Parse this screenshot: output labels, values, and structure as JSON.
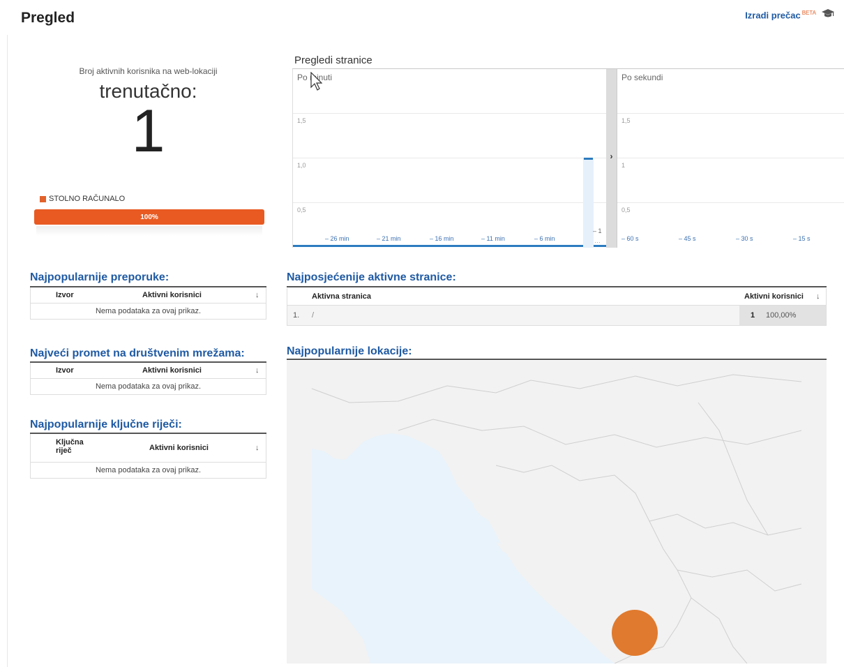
{
  "header": {
    "title": "Pregled",
    "shortcut_label": "Izradi prečac",
    "shortcut_badge": "BETA",
    "icon": "graduation-cap-icon"
  },
  "active_users": {
    "caption": "Broj aktivnih korisnika na web-lokaciji",
    "now": "trenutačno:",
    "count": "1",
    "device": {
      "label": "STOLNO RAČUNALO",
      "percent_label": "100%",
      "share": 1.0,
      "color": "#e2622b"
    }
  },
  "pageviews": {
    "title": "Pregledi stranice",
    "per_minute": {
      "label": "Po minuti",
      "y_ticks": [
        "1,5",
        "1,0",
        "0,5"
      ],
      "x_ticks": [
        "– 26 min",
        "– 21 min",
        "– 16 min",
        "– 11 min",
        "– 6 min"
      ],
      "last_tick": "– 1",
      "ellipsis": "…"
    },
    "per_second": {
      "label": "Po sekundi",
      "y_ticks": [
        "1,5",
        "1",
        "0,5"
      ],
      "x_ticks": [
        "– 60 s",
        "– 45 s",
        "– 30 s",
        "– 15 s"
      ]
    },
    "expand_arrow": "›",
    "bar_color": "#2c7bbf"
  },
  "chart_data": {
    "type": "bar",
    "categories": [
      "– 26 min",
      "– 21 min",
      "– 16 min",
      "– 11 min",
      "– 6 min",
      "– 1"
    ],
    "values": [
      0,
      0,
      0,
      0,
      0,
      1
    ],
    "ylim": [
      0,
      1.5
    ],
    "title": "Pregledi stranice",
    "xlabel": "",
    "ylabel": ""
  },
  "referrals": {
    "title": "Najpopularnije preporuke:",
    "columns": [
      "Izvor",
      "Aktivni korisnici"
    ],
    "empty": "Nema podataka za ovaj prikaz.",
    "sort_icon": "↓"
  },
  "social": {
    "title": "Najveći promet na društvenim mrežama:",
    "columns": [
      "Izvor",
      "Aktivni korisnici"
    ],
    "empty": "Nema podataka za ovaj prikaz.",
    "sort_icon": "↓"
  },
  "keywords": {
    "title": "Najpopularnije ključne riječi:",
    "columns": [
      "Ključna riječ",
      "Aktivni korisnici"
    ],
    "empty": "Nema podataka za ovaj prikaz.",
    "sort_icon": "↓"
  },
  "active_pages": {
    "title": "Najposjećenije aktivne stranice:",
    "columns": [
      "Aktivna stranica",
      "Aktivni korisnici"
    ],
    "sort_icon": "↓",
    "rows": [
      {
        "index": "1.",
        "page": "/",
        "users": "1",
        "percent": "100,00%"
      }
    ]
  },
  "locations": {
    "title": "Najpopularnije lokacije:",
    "marker_color": "#e07a2e",
    "sea_color": "#e8f3fb",
    "land_color": "#f2f2f2"
  }
}
